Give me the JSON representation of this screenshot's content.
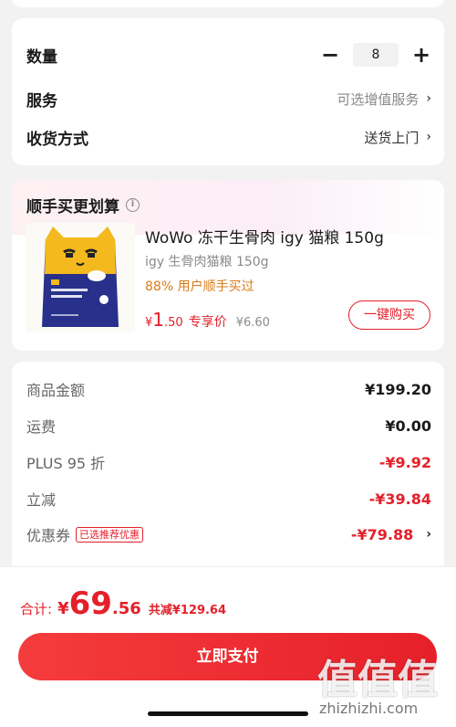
{
  "options": {
    "quantity_label": "数量",
    "quantity_value": "8",
    "minus_symbol": "−",
    "plus_symbol": "+",
    "service_label": "服务",
    "service_value": "可选增值服务",
    "delivery_label": "收货方式",
    "delivery_value": "送货上门",
    "chevron": "›"
  },
  "promo": {
    "title": "顺手买更划算",
    "info_glyph": "i",
    "product_name": "WoWo 冻干生骨肉 igy 猫粮 150g",
    "product_sub": "igy 生骨肉猫粮 150g",
    "product_rate": "88% 用户顺手买过",
    "price_symbol": "¥",
    "price_int": "1",
    "price_dec": ".50",
    "price_tag": "专享价",
    "price_orig": "¥6.60",
    "buy_label": "一键购买",
    "image_text": "冻干生骨肉 全价成猫粮"
  },
  "summary": {
    "rows": [
      {
        "label": "商品金额",
        "value": "¥199.20"
      },
      {
        "label": "运费",
        "value": "¥0.00"
      },
      {
        "label": "PLUS 95 折",
        "value": "-¥9.92"
      },
      {
        "label": "立减",
        "value": "-¥39.84"
      },
      {
        "label": "优惠券",
        "value": "-¥79.88",
        "tag": "已选推荐优惠"
      }
    ]
  },
  "footer": {
    "total_label": "合计:",
    "total_symbol": "¥",
    "total_int": "69",
    "total_dec": ".56",
    "total_saved": "共减¥129.64",
    "pay_label": "立即支付"
  },
  "watermark": {
    "big": "值值值",
    "small": "zhizhizhi.com"
  },
  "colors": {
    "accent_red": "#e4202a",
    "highlight_orange": "#d97a1b",
    "page_bg": "#f2f2f2"
  },
  "icons": {
    "info": "info-circle-icon",
    "chevron": "chevron-right-icon"
  }
}
